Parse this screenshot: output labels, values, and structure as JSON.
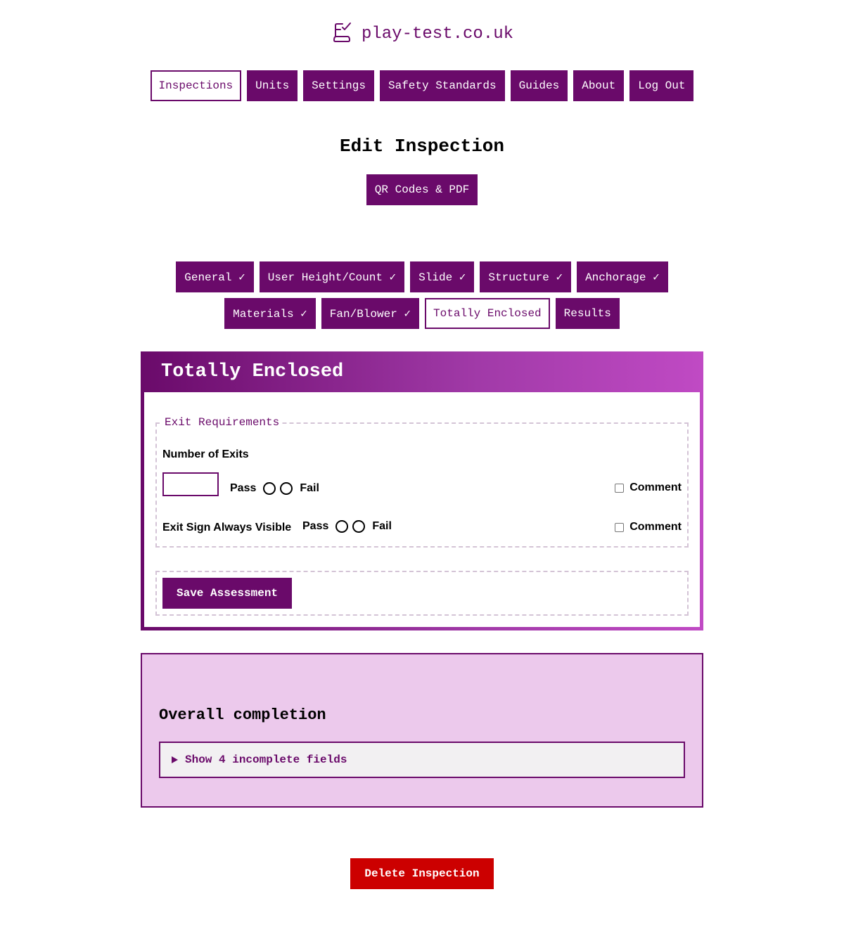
{
  "header": {
    "site_name": "play-test.co.uk",
    "logo_icon": "bouncy-castle-check-icon"
  },
  "nav": {
    "items": [
      {
        "label": "Inspections",
        "active": true
      },
      {
        "label": "Units"
      },
      {
        "label": "Settings"
      },
      {
        "label": "Safety Standards"
      },
      {
        "label": "Guides"
      },
      {
        "label": "About"
      },
      {
        "label": "Log Out"
      }
    ]
  },
  "page": {
    "title": "Edit Inspection",
    "qr_button": "QR Codes & PDF"
  },
  "tabs": {
    "row1": [
      "General ✓",
      "User Height/Count ✓",
      "Slide ✓",
      "Structure ✓",
      "Anchorage ✓"
    ],
    "row2": [
      "Materials ✓",
      "Fan/Blower ✓",
      "Totally Enclosed",
      "Results"
    ],
    "active": "Totally Enclosed"
  },
  "panel": {
    "title": "Totally Enclosed",
    "fieldset_legend": "Exit Requirements",
    "exits_label": "Number of Exits",
    "exits_value": "",
    "sign_label": "Exit Sign Always Visible",
    "pass_label": "Pass",
    "fail_label": "Fail",
    "comment_label": "Comment",
    "save_button": "Save Assessment"
  },
  "completion": {
    "title": "Overall completion",
    "details_summary": "Show 4 incomplete fields"
  },
  "delete_button": "Delete Inspection",
  "colors": {
    "brand": "#6a0a6a",
    "danger": "#cc0000",
    "completion_bg": "#ecc9ec"
  }
}
